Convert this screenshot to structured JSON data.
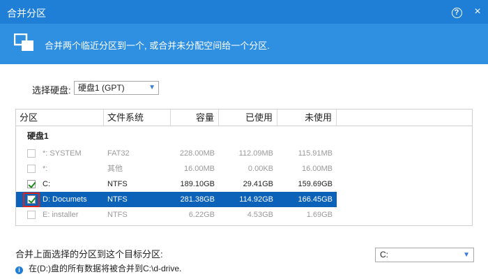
{
  "window": {
    "title": "合并分区",
    "help_icon": "help-icon",
    "close_icon": "close-icon",
    "help_glyph": "?",
    "close_glyph": "×"
  },
  "banner": {
    "text": "合并两个临近分区到一个, 或合并未分配空间给一个分区.",
    "icon": "merge-icon"
  },
  "disk_select": {
    "label": "选择硬盘:",
    "value": "硬盘1 (GPT)"
  },
  "table": {
    "columns": [
      "分区",
      "文件系统",
      "容量",
      "已使用",
      "未使用"
    ],
    "group": "硬盘1",
    "rows": [
      {
        "name": "*: SYSTEM",
        "fs": "FAT32",
        "capacity": "228.00MB",
        "used": "112.09MB",
        "free": "115.91MB",
        "checked": false,
        "enabled": false,
        "selected": false
      },
      {
        "name": "*:",
        "fs": "其他",
        "capacity": "16.00MB",
        "used": "0.00KB",
        "free": "16.00MB",
        "checked": false,
        "enabled": false,
        "selected": false
      },
      {
        "name": "C:",
        "fs": "NTFS",
        "capacity": "189.10GB",
        "used": "29.41GB",
        "free": "159.69GB",
        "checked": true,
        "enabled": true,
        "selected": false
      },
      {
        "name": "D: Documets",
        "fs": "NTFS",
        "capacity": "281.38GB",
        "used": "114.92GB",
        "free": "166.45GB",
        "checked": true,
        "enabled": true,
        "selected": true
      },
      {
        "name": "E: installer",
        "fs": "NTFS",
        "capacity": "6.22GB",
        "used": "4.53GB",
        "free": "1.69GB",
        "checked": false,
        "enabled": false,
        "selected": false
      }
    ]
  },
  "target": {
    "label": "合并上面选择的分区到这个目标分区:",
    "value": "C:"
  },
  "info": {
    "glyph": "i",
    "text": "在(D:)盘的所有数据将被合并到C:\\d-drive."
  },
  "colors": {
    "titlebar": "#1f7fd6",
    "banner": "#2f8fe0",
    "selected_row": "#0b62b8",
    "highlight": "#d9261c"
  }
}
